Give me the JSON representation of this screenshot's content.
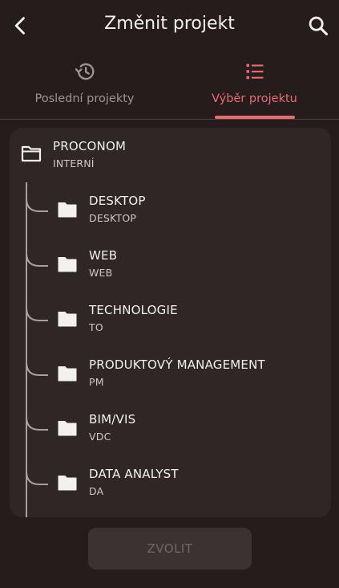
{
  "header": {
    "title": "Změnit projekt"
  },
  "tabs": [
    {
      "label": "Poslední projekty",
      "icon": "history-icon",
      "active": false
    },
    {
      "label": "Výběr projektu",
      "icon": "list-icon",
      "active": true
    }
  ],
  "tree": {
    "root": {
      "name": "PROCONOM",
      "code": "INTERNÍ"
    },
    "children": [
      {
        "name": "DESKTOP",
        "code": "DESKTOP"
      },
      {
        "name": "WEB",
        "code": "WEB"
      },
      {
        "name": "TECHNOLOGIE",
        "code": "TO"
      },
      {
        "name": "PRODUKTOVÝ MANAGEMENT",
        "code": "PM"
      },
      {
        "name": "BIM/VIS",
        "code": "VDC"
      },
      {
        "name": "DATA ANALYST",
        "code": "DA"
      }
    ]
  },
  "action": {
    "submit_label": "ZVOLIT",
    "enabled": false
  },
  "colors": {
    "background": "#241d1c",
    "card": "#2e2726",
    "accent": "#ec6b72",
    "inactive_text": "#9d9594",
    "tree_line": "#a7a2a1"
  }
}
